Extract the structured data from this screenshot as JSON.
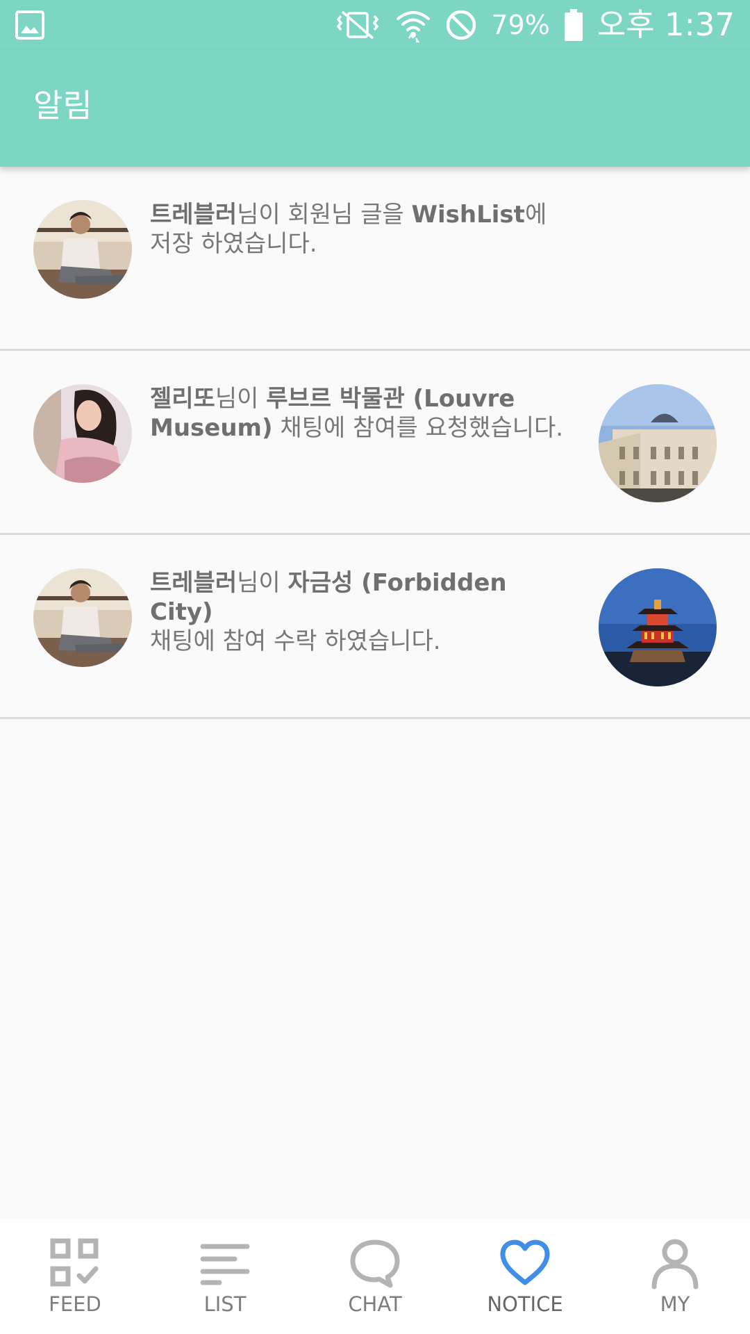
{
  "status_bar": {
    "battery": "79%",
    "time": "오후 1:37",
    "icons": [
      "image-icon",
      "vibrate-off-icon",
      "wifi-icon",
      "do-not-disturb-icon",
      "battery-icon"
    ]
  },
  "app_bar": {
    "title": "알림"
  },
  "notifications": [
    {
      "parts": [
        {
          "text": "트레블러",
          "bold": true
        },
        {
          "text": "님이 회원님 글을 ",
          "bold": false
        },
        {
          "text": "WishList",
          "bold": true
        },
        {
          "text": "에",
          "bold": false
        },
        {
          "text": "저장 하였습니다.",
          "bold": false,
          "newline": true
        }
      ],
      "has_thumbnail": false
    },
    {
      "parts": [
        {
          "text": "젤리또",
          "bold": true
        },
        {
          "text": "님이 ",
          "bold": false
        },
        {
          "text": "루브르 박물관 (Louvre Museum)",
          "bold": true
        },
        {
          "text": " 채팅에 참여를 요청했습니다.",
          "bold": false
        }
      ],
      "has_thumbnail": true
    },
    {
      "parts": [
        {
          "text": "트레블러",
          "bold": true
        },
        {
          "text": "님이 ",
          "bold": false
        },
        {
          "text": "자금성 (Forbidden City)",
          "bold": true
        },
        {
          "text": "채팅에 참여 수락 하였습니다.",
          "bold": false,
          "newline": true
        }
      ],
      "has_thumbnail": true
    }
  ],
  "bottom_nav": {
    "items": [
      {
        "label": "FEED",
        "icon": "feed-grid-icon"
      },
      {
        "label": "LIST",
        "icon": "list-lines-icon"
      },
      {
        "label": "CHAT",
        "icon": "chat-bubble-icon"
      },
      {
        "label": "NOTICE",
        "icon": "heart-icon",
        "active": true
      },
      {
        "label": "MY",
        "icon": "person-icon"
      }
    ],
    "active_color": "#3f8fe8",
    "inactive_color": "#b4b4b4"
  },
  "colors": {
    "accent": "#7dd6c3",
    "background": "#fafafa"
  }
}
